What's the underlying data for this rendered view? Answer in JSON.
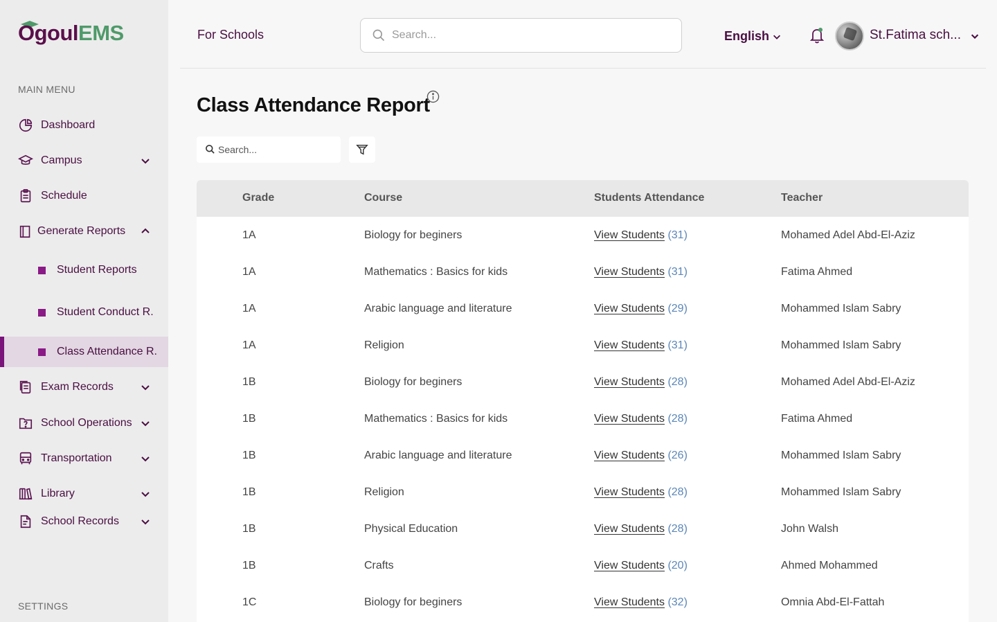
{
  "brand": {
    "part1": "Ogoul",
    "part2": "EMS"
  },
  "sidebar": {
    "main_menu_label": "MAIN MENU",
    "settings_label": "SETTINGS",
    "items": [
      {
        "label": "Dashboard",
        "icon": "dashboard-icon"
      },
      {
        "label": "Campus",
        "icon": "campus-icon"
      },
      {
        "label": "Schedule",
        "icon": "schedule-icon"
      },
      {
        "label": "Generate Reports",
        "icon": "reports-icon"
      },
      {
        "label": "Exam Records",
        "icon": "exam-records-icon"
      },
      {
        "label": "School Operations",
        "icon": "school-operations-icon"
      },
      {
        "label": "Transportation",
        "icon": "bus-icon"
      },
      {
        "label": "Library",
        "icon": "library-icon"
      },
      {
        "label": "School Records",
        "icon": "school-records-icon"
      }
    ],
    "sub_items": [
      {
        "label": "Student Reports"
      },
      {
        "label": "Student Conduct R."
      },
      {
        "label": "Class Attendance R."
      }
    ]
  },
  "topbar": {
    "for_schools": "For Schools",
    "search_placeholder": "Search...",
    "language": "English",
    "user_name": "St.Fatima sch..."
  },
  "main": {
    "title": "Class Attendance Report",
    "search_placeholder": "Search...",
    "columns": [
      "Grade",
      "Course",
      "Students Attendance",
      "Teacher"
    ],
    "link_label": "View Students",
    "rows": [
      {
        "grade": "1A",
        "course": "Biology for beginers",
        "count": "(31)",
        "teacher": "Mohamed Adel Abd-El-Aziz"
      },
      {
        "grade": "1A",
        "course": "Mathematics : Basics for kids",
        "count": "(31)",
        "teacher": "Fatima Ahmed"
      },
      {
        "grade": "1A",
        "course": "Arabic language and literature",
        "count": "(29)",
        "teacher": "Mohammed Islam Sabry"
      },
      {
        "grade": "1A",
        "course": "Religion",
        "count": "(31)",
        "teacher": "Mohammed Islam Sabry"
      },
      {
        "grade": "1B",
        "course": "Biology for beginers",
        "count": "(28)",
        "teacher": "Mohamed Adel Abd-El-Aziz"
      },
      {
        "grade": "1B",
        "course": "Mathematics : Basics for kids",
        "count": "(28)",
        "teacher": "Fatima Ahmed"
      },
      {
        "grade": "1B",
        "course": "Arabic language and literature",
        "count": "(26)",
        "teacher": "Mohammed Islam Sabry"
      },
      {
        "grade": "1B",
        "course": "Religion",
        "count": "(28)",
        "teacher": "Mohammed Islam Sabry"
      },
      {
        "grade": "1B",
        "course": "Physical Education",
        "count": "(28)",
        "teacher": "John Walsh"
      },
      {
        "grade": "1B",
        "course": "Crafts",
        "count": "(20)",
        "teacher": "Ahmed Mohammed"
      },
      {
        "grade": "1C",
        "course": "Biology for beginers",
        "count": "(32)",
        "teacher": "Omnia Abd-El-Fattah"
      }
    ]
  },
  "colors": {
    "brand_purple": "#5a0f4a",
    "brand_green": "#4f9a6a",
    "active_bg": "#e2d7e2",
    "accent": "#7a137a",
    "count_blue": "#5b86b8"
  }
}
